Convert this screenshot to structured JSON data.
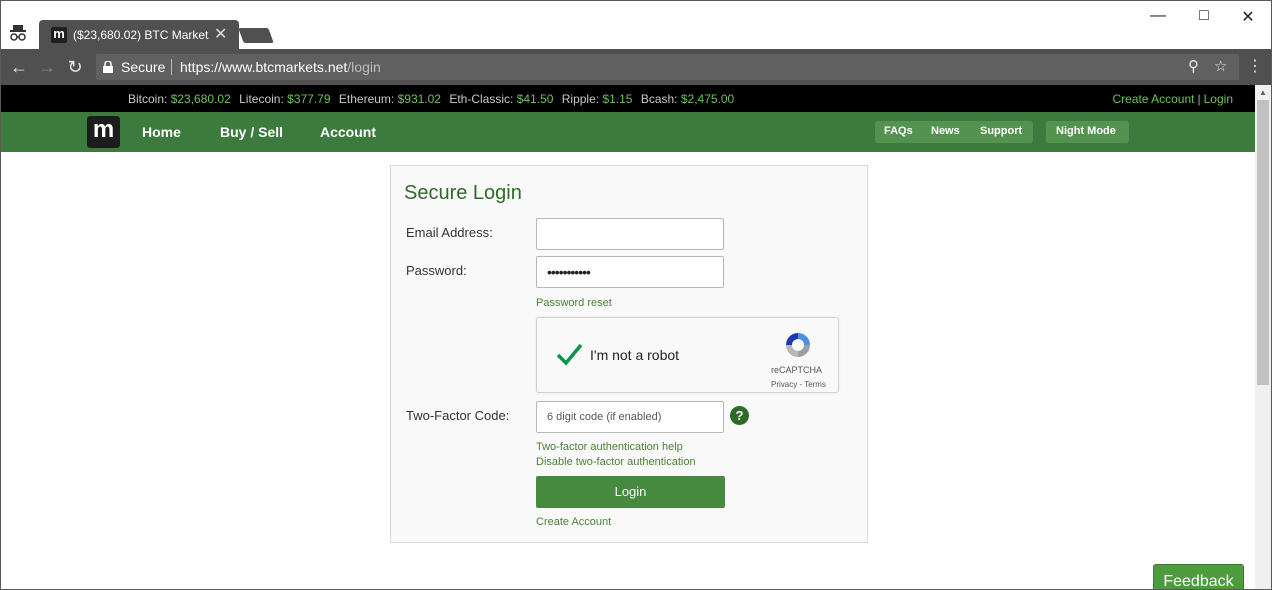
{
  "browser": {
    "tab_title": "($23,680.02) BTC Markets",
    "tab_close": "✕",
    "secure_label": "Secure",
    "url_host": "https://www.btcmarkets.net",
    "url_path": "/login"
  },
  "ticker": {
    "prices": [
      {
        "label": "Bitcoin:",
        "value": "$23,680.02"
      },
      {
        "label": "Litecoin:",
        "value": "$377.79"
      },
      {
        "label": "Ethereum:",
        "value": "$931.02"
      },
      {
        "label": "Eth-Classic:",
        "value": "$41.50"
      },
      {
        "label": "Ripple:",
        "value": "$1.15"
      },
      {
        "label": "Bcash:",
        "value": "$2,475.00"
      }
    ],
    "create_account": "Create Account",
    "separator": "|",
    "login": "Login"
  },
  "nav": {
    "logo_letter": "m",
    "home": "Home",
    "buy_sell": "Buy / Sell",
    "account": "Account",
    "faqs": "FAQs",
    "news": "News",
    "support": "Support",
    "night_mode": "Night Mode"
  },
  "login": {
    "title": "Secure Login",
    "email_label": "Email Address:",
    "email_value": "",
    "password_label": "Password:",
    "password_value": "•••••••••••",
    "password_reset": "Password reset",
    "captcha_text": "I'm not a robot",
    "captcha_brand": "reCAPTCHA",
    "captcha_terms": "Privacy - Terms",
    "twofa_label": "Two-Factor Code:",
    "twofa_placeholder": "6 digit code (if enabled)",
    "twofa_help_icon": "?",
    "twofa_help": "Two-factor authentication help",
    "twofa_disable": "Disable two-factor authentication",
    "login_button": "Login",
    "create_account": "Create Account"
  },
  "feedback": "Feedback",
  "colors": {
    "brand_green": "#3d7a3d",
    "price_green": "#6fc15a",
    "button_green": "#468a40"
  }
}
